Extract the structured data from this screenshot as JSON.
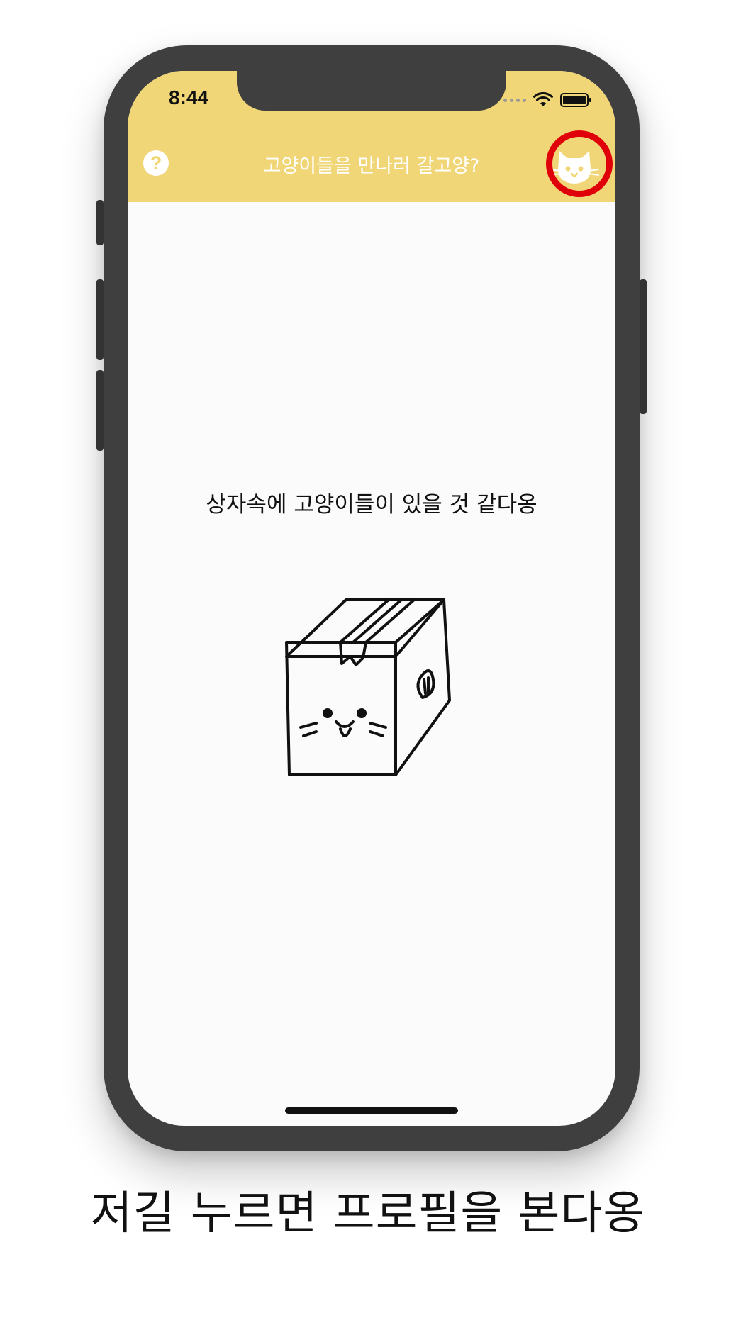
{
  "status_bar": {
    "time": "8:44"
  },
  "nav_bar": {
    "title": "고양이들을 만나러 갈고양?",
    "help_icon": "?"
  },
  "content": {
    "message": "상자속에 고양이들이 있을 것 같다옹"
  },
  "caption": "저길 누르면 프로필을 본다옹",
  "colors": {
    "nav_bar": "#f0d676",
    "highlight": "#e0000a",
    "phone_frame": "#3f3f3f",
    "screen_bg": "#fbfbfb"
  },
  "icons": {
    "help": "question-circle-icon",
    "profile": "cat-face-icon",
    "illustration": "cat-box-illustration"
  }
}
